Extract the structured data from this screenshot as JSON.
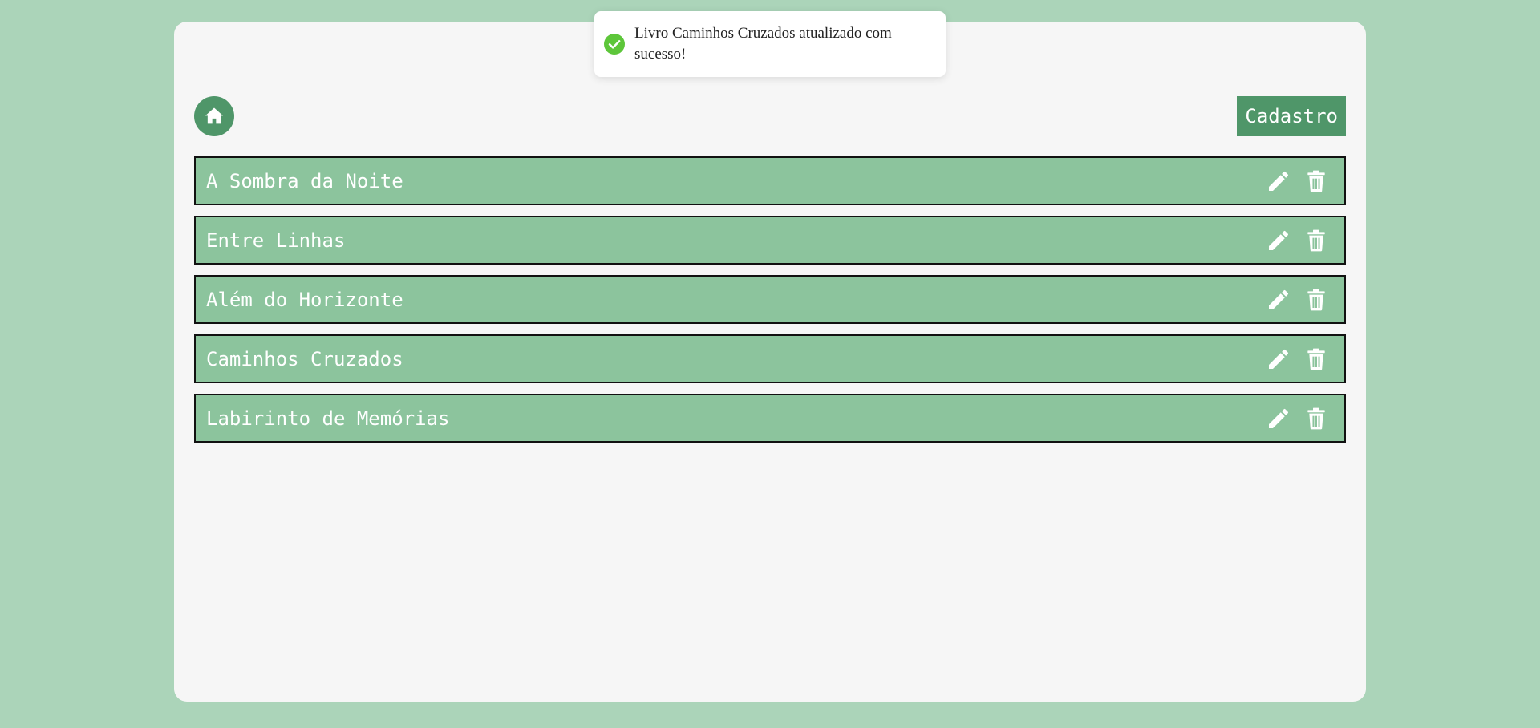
{
  "toast": {
    "message": "Livro Caminhos Cruzados atualizado com sucesso!",
    "icon": "check-circle-icon",
    "color": "#5dc63a"
  },
  "header": {
    "home_icon": "home-icon",
    "register_label": "Cadastro"
  },
  "books": [
    {
      "title": "A Sombra da Noite"
    },
    {
      "title": "Entre Linhas"
    },
    {
      "title": "Além do Horizonte"
    },
    {
      "title": "Caminhos Cruzados"
    },
    {
      "title": "Labirinto de Memórias"
    }
  ],
  "row_actions": {
    "edit_icon": "pencil-icon",
    "delete_icon": "trash-icon"
  },
  "colors": {
    "page_background": "#abd4b9",
    "panel_background": "#f6f6f6",
    "accent": "#4f9669",
    "row_background": "#8cc49d",
    "row_border": "#111111",
    "toast_success": "#5dc63a"
  }
}
